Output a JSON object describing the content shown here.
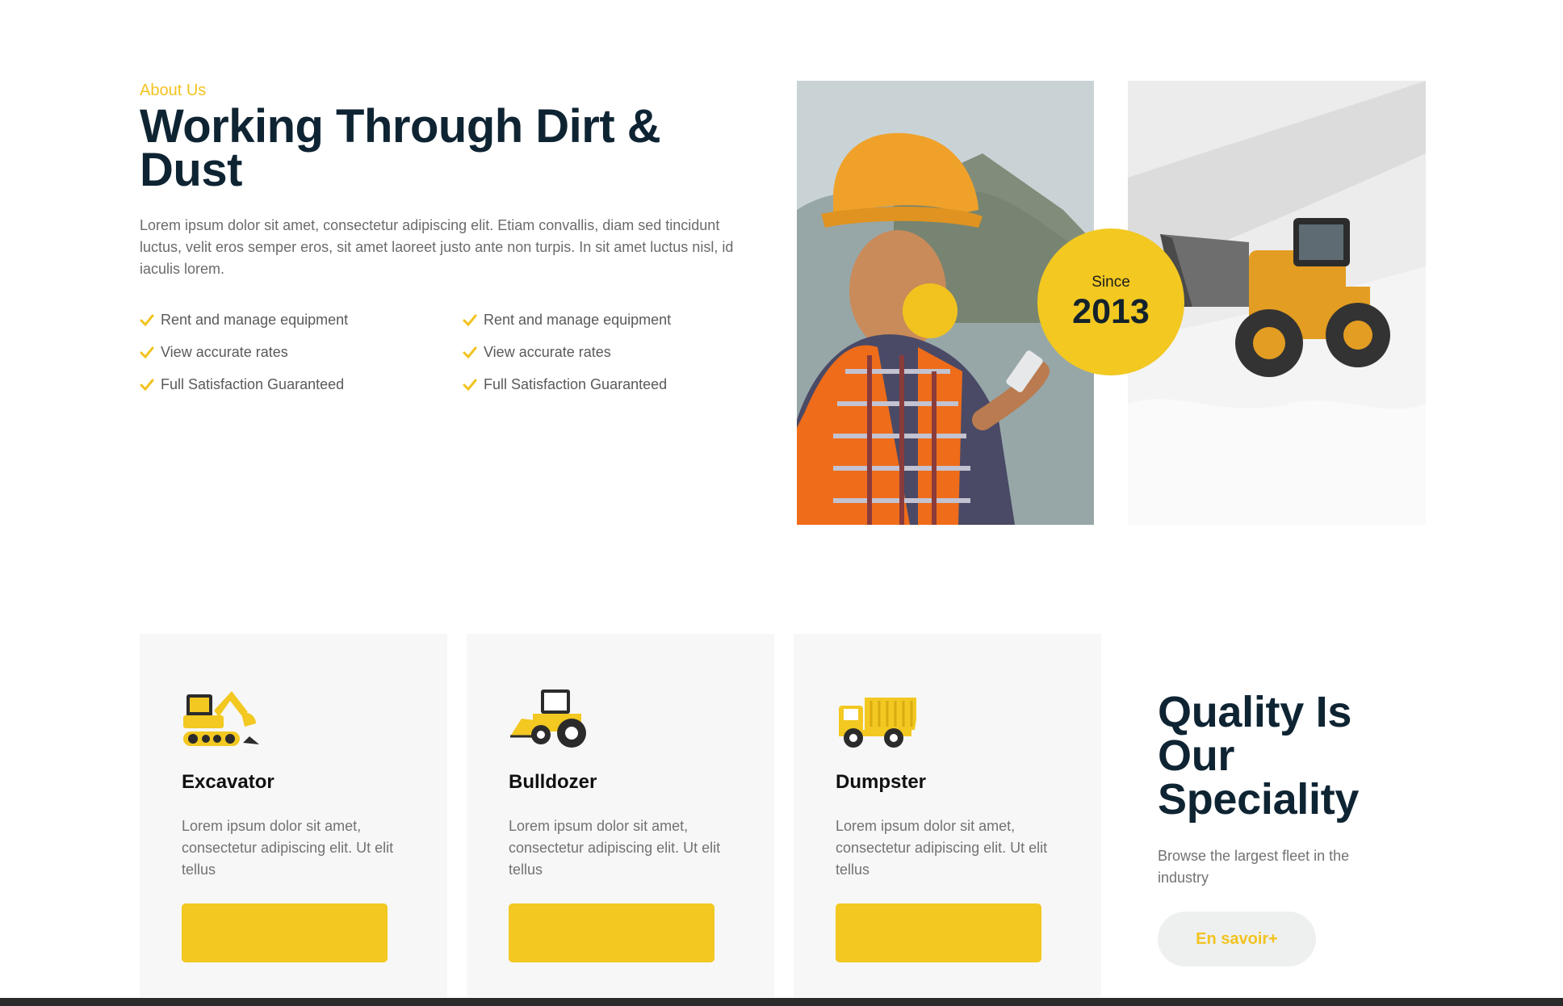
{
  "about": {
    "eyebrow": "About Us",
    "heading": "Working Through Dirt & Dust",
    "paragraph": "Lorem ipsum dolor sit amet, consectetur adipiscing elit. Etiam convallis, diam sed tincidunt luctus, velit eros semper eros, sit amet laoreet justo ante non turpis. In sit amet luctus nisl, id iaculis lorem.",
    "checklist_left": [
      "Rent and manage equipment",
      "View accurate rates",
      "Full Satisfaction Guaranteed"
    ],
    "checklist_right": [
      "Rent and manage equipment",
      "View accurate rates",
      "Full Satisfaction Guaranteed"
    ]
  },
  "since": {
    "label": "Since",
    "year": "2013"
  },
  "cards": [
    {
      "icon": "excavator-icon",
      "title": "Excavator",
      "description": "Lorem ipsum dolor sit amet, consectetur adipiscing elit. Ut elit tellus",
      "button_label": ""
    },
    {
      "icon": "bulldozer-icon",
      "title": "Bulldozer",
      "description": "Lorem ipsum dolor sit amet, consectetur adipiscing elit. Ut elit tellus",
      "button_label": ""
    },
    {
      "icon": "dump-truck-icon",
      "title": "Dumpster",
      "description": "Lorem ipsum dolor sit amet, consectetur adipiscing elit. Ut elit tellus",
      "button_label": ""
    }
  ],
  "quality": {
    "title": "Quality Is Our Speciality",
    "subtitle": "Browse the largest fleet in the industry",
    "button_label": "En savoir+"
  },
  "colors": {
    "accent": "#f2c821",
    "heading": "#0f2433",
    "card_bg": "#f7f7f7"
  }
}
